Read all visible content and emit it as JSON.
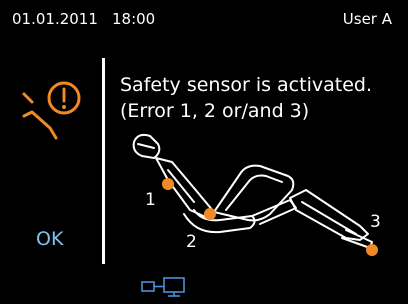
{
  "status": {
    "date": "01.01.2011",
    "time": "18:00",
    "user": "User A"
  },
  "message": {
    "line1": "Safety sensor is activated.",
    "line2": "(Error 1, 2 or/and 3)"
  },
  "sensors": {
    "label_1": "1",
    "label_2": "2",
    "label_3": "3"
  },
  "buttons": {
    "ok_label": "OK"
  },
  "icons": {
    "warning": "safety-warning-icon",
    "network": "network-connection-icon"
  },
  "colors": {
    "background": "#000000",
    "text": "#ffffff",
    "accent_orange": "#f08a24",
    "ok_blue": "#7ec3ee",
    "icon_blue": "#4f8fd6"
  }
}
